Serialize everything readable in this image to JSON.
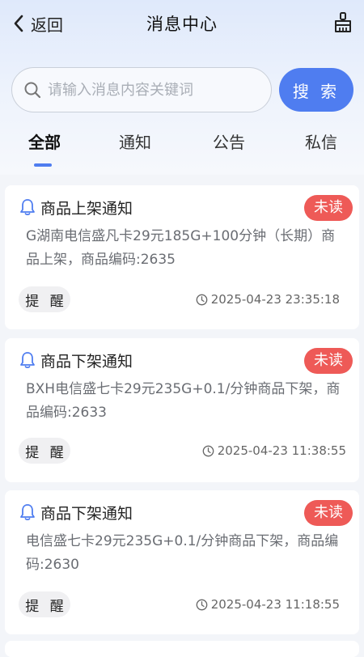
{
  "header": {
    "back_label": "返回",
    "title": "消息中心"
  },
  "search": {
    "placeholder": "请输入消息内容关键词",
    "button_label": "搜 索"
  },
  "tabs": [
    {
      "label": "全部",
      "active": true
    },
    {
      "label": "通知",
      "active": false
    },
    {
      "label": "公告",
      "active": false
    },
    {
      "label": "私信",
      "active": false
    }
  ],
  "messages": [
    {
      "title": "商品上架通知",
      "status": "未读",
      "content": "G湖南电信盛凡卡29元185G+100分钟（长期）商品上架，商品编码:2635",
      "action": "提 醒",
      "time": "2025-04-23 23:35:18"
    },
    {
      "title": "商品下架通知",
      "status": "未读",
      "content": "BXH电信盛七卡29元235G+0.1/分钟商品下架，商品编码:2633",
      "action": "提 醒",
      "time": "2025-04-23 11:38:55"
    },
    {
      "title": "商品下架通知",
      "status": "未读",
      "content": "电信盛七卡29元235G+0.1/分钟商品下架，商品编码:2630",
      "action": "提 醒",
      "time": "2025-04-23 11:18:55"
    }
  ],
  "colors": {
    "accent": "#4f7df0",
    "unread_badge": "#ee5a57"
  },
  "icons": {
    "back": "chevron-left-icon",
    "clean": "broom-icon",
    "search": "search-icon",
    "bell": "bell-icon",
    "clock": "clock-icon"
  }
}
